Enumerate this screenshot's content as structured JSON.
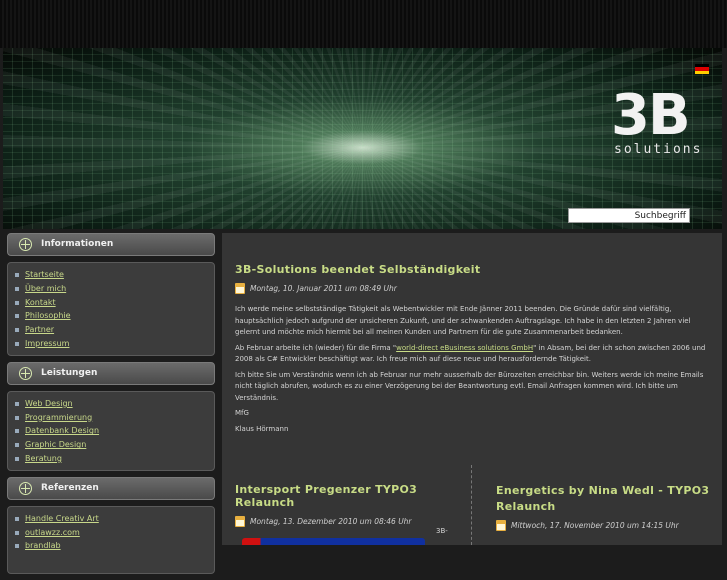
{
  "header": {
    "logo_big": "3B",
    "logo_small": "solutions",
    "search_placeholder": "Suchbegriff",
    "flag_colors": [
      "#000000",
      "#dd0000",
      "#ffce00"
    ]
  },
  "sidebar": {
    "sections": [
      {
        "title": "Informationen",
        "items": [
          "Startseite",
          "Über mich",
          "Kontakt",
          "Philosophie",
          "Partner",
          "Impressum"
        ]
      },
      {
        "title": "Leistungen",
        "items": [
          "Web Design",
          "Programmierung",
          "Datenbank Design",
          "Graphic Design",
          "Beratung"
        ]
      },
      {
        "title": "Referenzen",
        "items": [
          "Handle Creativ Art",
          "outlawzz.com",
          "brandlab"
        ]
      }
    ]
  },
  "main": {
    "post": {
      "title": "3B-Solutions beendet Selbständigkeit",
      "date": "Montag, 10. Januar 2011 um 08:49 Uhr",
      "p1": "Ich werde meine selbstständige Tätigkeit als Webentwickler mit Ende Jänner 2011 beenden. Die Gründe dafür sind vielfältig, hauptsächlich jedoch aufgrund der unsicheren Zukunft, und der schwankenden Auftragslage. Ich habe in den letzten 2 Jahren viel gelernt und möchte mich hiermit bei all meinen Kunden und Partnern für die gute Zusammenarbeit bedanken.",
      "p2_before": "Ab Februar arbeite ich (wieder) für die Firma \"",
      "p2_link": "world-direct eBusiness solutions GmbH",
      "p2_after": "\" in Absam, bei der ich schon zwischen 2006 und 2008 als C# Entwickler beschäftigt war. Ich freue mich auf diese neue und herausfordernde Tätigkeit.",
      "p3": "Ich bitte Sie um Verständnis wenn ich ab Februar nur mehr ausserhalb der Bürozeiten erreichbar bin. Weiters werde ich meine Emails nicht täglich abrufen, wodurch es zu einer Verzögerung bei der Beantwortung evtl. Email Anfragen kommen wird. Ich bitte um Verständnis.",
      "p4": "MfG",
      "p5": "Klaus Hörmann"
    },
    "teaser_left": {
      "title": "Intersport Pregenzer TYPO3 Relaunch",
      "date": "Montag, 13. Dezember 2010 um 08:46 Uhr",
      "side_text": "3B-"
    },
    "teaser_right": {
      "title": "Energetics by Nina Wedl - TYPO3 Relaunch",
      "date": "Mittwoch, 17. November 2010 um 14:15 Uhr"
    }
  }
}
